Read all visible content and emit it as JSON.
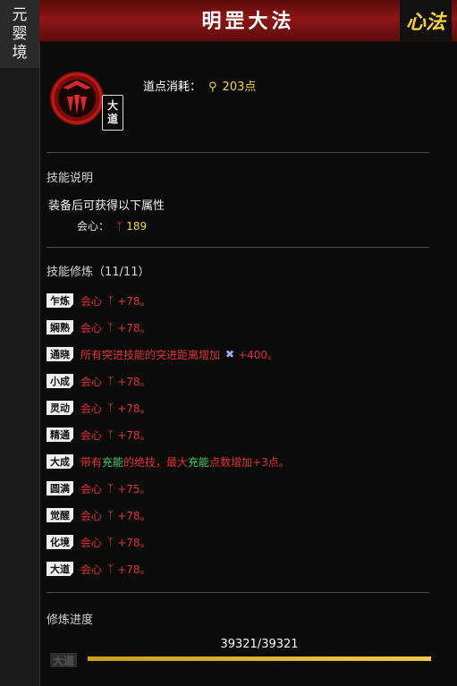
{
  "side": {
    "realm_label": [
      "元",
      "婴",
      "境"
    ]
  },
  "header": {
    "title": "明罡大法",
    "tag": "心法"
  },
  "skill": {
    "badge": [
      "大",
      "道"
    ]
  },
  "cost": {
    "label": "道点消耗：",
    "value": "203点",
    "icon": "location-pin-icon"
  },
  "description": {
    "title": "技能说明",
    "text": "装备后可获得以下属性",
    "stat_label": "会心：",
    "stat_value": "189"
  },
  "training": {
    "title": "技能修炼（11/11）",
    "tiers": [
      {
        "badge": "乍炼",
        "parts": [
          "会心",
          "+78。"
        ]
      },
      {
        "badge": "娴熟",
        "parts": [
          "会心",
          "+78。"
        ]
      },
      {
        "badge": "通晓",
        "parts": [
          "所有突进技能的突进距离增加",
          "+400。"
        ]
      },
      {
        "badge": "小成",
        "parts": [
          "会心",
          "+78。"
        ]
      },
      {
        "badge": "灵动",
        "parts": [
          "会心",
          "+78。"
        ]
      },
      {
        "badge": "精通",
        "parts": [
          "会心",
          "+78。"
        ]
      },
      {
        "badge": "大成",
        "text": "带有充能的绝技，最大充能点数增加+3点。"
      },
      {
        "badge": "圆满",
        "parts": [
          "会心",
          "+75。"
        ]
      },
      {
        "badge": "觉醒",
        "parts": [
          "会心",
          "+78。"
        ]
      },
      {
        "badge": "化境",
        "parts": [
          "会心",
          "+78。"
        ]
      },
      {
        "badge": "大道",
        "parts": [
          "会心",
          "+78。"
        ]
      }
    ]
  },
  "progress": {
    "title": "修炼进度",
    "value_text": "39321/39321",
    "label": "大道",
    "fraction": 1.0
  },
  "colors": {
    "header_red": "#8e1616",
    "accent_yellow": "#f2d53c",
    "stat_red": "#e23232",
    "special_green": "#3fd15a"
  }
}
